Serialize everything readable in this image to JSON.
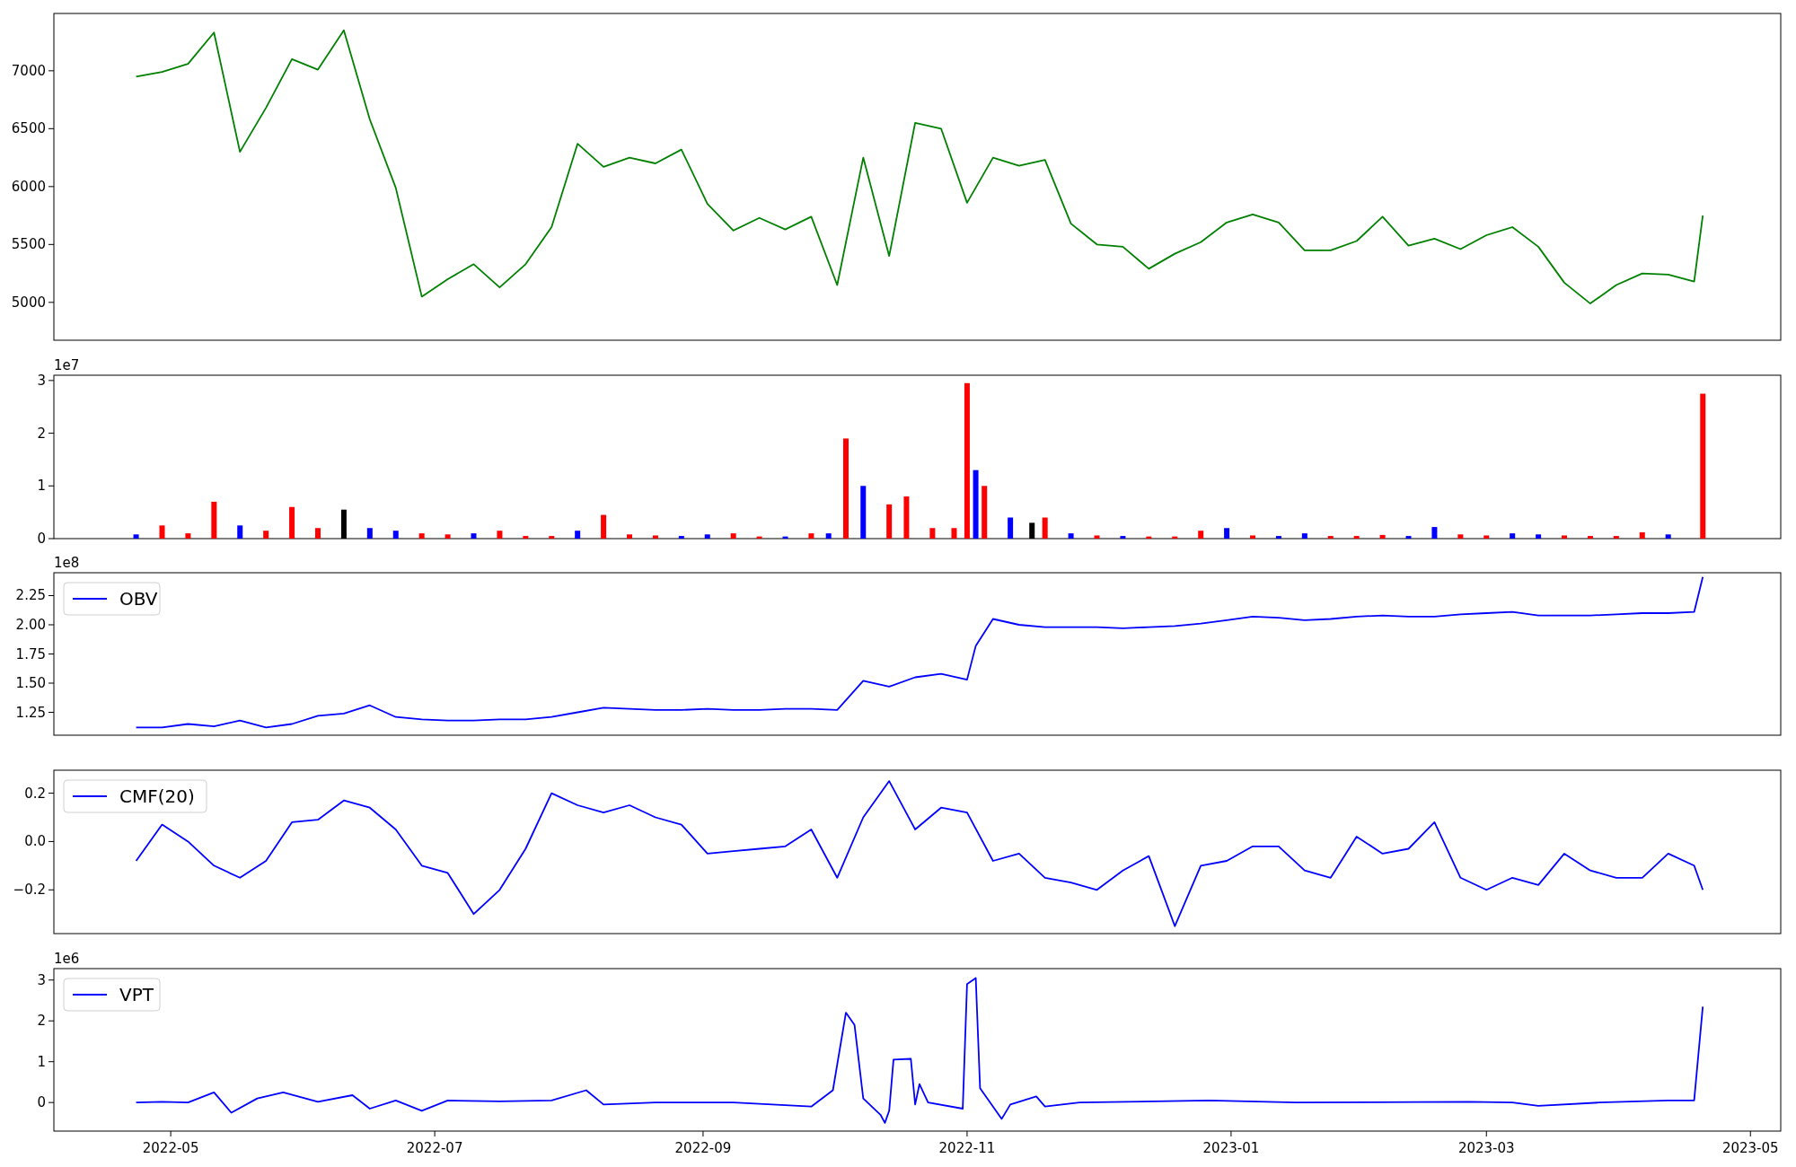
{
  "panels": [
    {
      "chart_data": {
        "type": "line",
        "x": [
          "2022-04-23",
          "2022-04-29",
          "2022-05-05",
          "2022-05-11",
          "2022-05-17",
          "2022-05-23",
          "2022-05-29",
          "2022-06-04",
          "2022-06-10",
          "2022-06-16",
          "2022-06-22",
          "2022-06-28",
          "2022-07-04",
          "2022-07-10",
          "2022-07-16",
          "2022-07-22",
          "2022-07-28",
          "2022-08-03",
          "2022-08-09",
          "2022-08-15",
          "2022-08-21",
          "2022-08-27",
          "2022-09-02",
          "2022-09-08",
          "2022-09-14",
          "2022-09-20",
          "2022-09-26",
          "2022-10-02",
          "2022-10-08",
          "2022-10-14",
          "2022-10-20",
          "2022-10-26",
          "2022-11-01",
          "2022-11-07",
          "2022-11-13",
          "2022-11-19",
          "2022-11-25",
          "2022-12-01",
          "2022-12-07",
          "2022-12-13",
          "2022-12-19",
          "2022-12-25",
          "2022-12-31",
          "2023-01-06",
          "2023-01-12",
          "2023-01-18",
          "2023-01-24",
          "2023-01-30",
          "2023-02-05",
          "2023-02-11",
          "2023-02-17",
          "2023-02-23",
          "2023-03-01",
          "2023-03-07",
          "2023-03-13",
          "2023-03-19",
          "2023-03-25",
          "2023-03-31",
          "2023-04-06",
          "2023-04-12",
          "2023-04-18",
          "2023-04-20"
        ],
        "xlim": [
          "2022-04-04",
          "2023-05-08"
        ],
        "ylim": [
          4673,
          7495
        ],
        "yticks": [
          5000,
          5500,
          6000,
          6500,
          7000
        ],
        "series": [
          {
            "color": "#008000",
            "values": [
              6950,
              6990,
              7060,
              7330,
              6300,
              6680,
              7100,
              7010,
              7350,
              6580,
              5990,
              5050,
              5200,
              5330,
              5130,
              5330,
              5650,
              6370,
              6170,
              6250,
              6200,
              6320,
              5850,
              5620,
              5730,
              5630,
              5740,
              5150,
              6250,
              5400,
              6550,
              6500,
              5860,
              6250,
              6180,
              6230,
              5680,
              5500,
              5480,
              5290,
              5420,
              5520,
              5690,
              5760,
              5690,
              5450,
              5450,
              5530,
              5740,
              5490,
              5550,
              5460,
              5580,
              5650,
              5480,
              5170,
              4990,
              5150,
              5250,
              5240,
              5180,
              5750
            ]
          }
        ]
      }
    },
    {
      "offset_label": "1e7",
      "chart_data": {
        "type": "bar",
        "x": [
          "2022-04-23",
          "2022-04-29",
          "2022-05-05",
          "2022-05-11",
          "2022-05-17",
          "2022-05-23",
          "2022-05-29",
          "2022-06-04",
          "2022-06-10",
          "2022-06-16",
          "2022-06-22",
          "2022-06-28",
          "2022-07-04",
          "2022-07-10",
          "2022-07-16",
          "2022-07-22",
          "2022-07-28",
          "2022-08-03",
          "2022-08-09",
          "2022-08-15",
          "2022-08-21",
          "2022-08-27",
          "2022-09-02",
          "2022-09-08",
          "2022-09-14",
          "2022-09-20",
          "2022-09-26",
          "2022-09-30",
          "2022-10-04",
          "2022-10-08",
          "2022-10-14",
          "2022-10-18",
          "2022-10-24",
          "2022-10-29",
          "2022-11-01",
          "2022-11-03",
          "2022-11-05",
          "2022-11-11",
          "2022-11-16",
          "2022-11-19",
          "2022-11-25",
          "2022-12-01",
          "2022-12-07",
          "2022-12-13",
          "2022-12-19",
          "2022-12-25",
          "2022-12-31",
          "2023-01-06",
          "2023-01-12",
          "2023-01-18",
          "2023-01-24",
          "2023-01-30",
          "2023-02-05",
          "2023-02-11",
          "2023-02-17",
          "2023-02-23",
          "2023-03-01",
          "2023-03-07",
          "2023-03-13",
          "2023-03-19",
          "2023-03-25",
          "2023-03-31",
          "2023-04-06",
          "2023-04-12",
          "2023-04-20"
        ],
        "xlim": [
          "2022-04-04",
          "2023-05-08"
        ],
        "ylim": [
          0,
          3.1
        ],
        "yticks": [
          0,
          1,
          2,
          3
        ],
        "series": [
          {
            "color": "#ff0000",
            "values": [
              null,
              0.25,
              0.1,
              0.7,
              null,
              0.15,
              0.6,
              0.2,
              null,
              null,
              null,
              0.1,
              0.08,
              null,
              0.15,
              0.05,
              0.05,
              null,
              0.45,
              0.08,
              0.06,
              null,
              null,
              0.1,
              0.04,
              null,
              0.1,
              null,
              1.9,
              null,
              0.65,
              0.8,
              0.2,
              0.2,
              2.95,
              null,
              1.0,
              null,
              null,
              0.4,
              null,
              0.06,
              null,
              0.04,
              0.04,
              0.15,
              null,
              0.06,
              null,
              null,
              0.05,
              0.05,
              0.07,
              null,
              null,
              0.08,
              0.06,
              null,
              null,
              0.06,
              0.05,
              0.05,
              0.12,
              null,
              2.75
            ]
          },
          {
            "color": "#0000ff",
            "values": [
              0.08,
              null,
              null,
              null,
              0.25,
              null,
              null,
              null,
              null,
              0.2,
              0.15,
              null,
              null,
              0.1,
              null,
              null,
              null,
              0.15,
              null,
              null,
              null,
              0.05,
              0.08,
              null,
              null,
              0.04,
              null,
              0.1,
              null,
              1.0,
              null,
              null,
              null,
              null,
              null,
              1.3,
              null,
              0.4,
              null,
              null,
              0.1,
              null,
              0.05,
              null,
              null,
              null,
              0.2,
              null,
              0.05,
              0.1,
              null,
              null,
              null,
              0.05,
              0.22,
              null,
              null,
              0.1,
              0.08,
              null,
              null,
              null,
              null,
              0.08,
              null
            ]
          },
          {
            "color": "#000000",
            "values": [
              null,
              null,
              null,
              null,
              null,
              null,
              null,
              null,
              0.55,
              null,
              null,
              null,
              null,
              null,
              null,
              null,
              null,
              null,
              null,
              null,
              null,
              null,
              null,
              null,
              null,
              null,
              null,
              null,
              null,
              null,
              null,
              null,
              null,
              null,
              null,
              null,
              null,
              null,
              0.3,
              null,
              null,
              null,
              null,
              null,
              null,
              null,
              null,
              null,
              null,
              null,
              null,
              null,
              null,
              null,
              null,
              null,
              null,
              null,
              null,
              null,
              null,
              null,
              null,
              null,
              null
            ]
          }
        ]
      }
    },
    {
      "offset_label": "1e8",
      "chart_data": {
        "type": "line",
        "x": [
          "2022-04-23",
          "2022-04-29",
          "2022-05-05",
          "2022-05-11",
          "2022-05-17",
          "2022-05-23",
          "2022-05-29",
          "2022-06-04",
          "2022-06-10",
          "2022-06-16",
          "2022-06-22",
          "2022-06-28",
          "2022-07-04",
          "2022-07-10",
          "2022-07-16",
          "2022-07-22",
          "2022-07-28",
          "2022-08-03",
          "2022-08-09",
          "2022-08-15",
          "2022-08-21",
          "2022-08-27",
          "2022-09-02",
          "2022-09-08",
          "2022-09-14",
          "2022-09-20",
          "2022-09-26",
          "2022-10-02",
          "2022-10-08",
          "2022-10-14",
          "2022-10-20",
          "2022-10-26",
          "2022-11-01",
          "2022-11-03",
          "2022-11-07",
          "2022-11-13",
          "2022-11-19",
          "2022-11-25",
          "2022-12-01",
          "2022-12-07",
          "2022-12-13",
          "2022-12-19",
          "2022-12-25",
          "2022-12-31",
          "2023-01-06",
          "2023-01-12",
          "2023-01-18",
          "2023-01-24",
          "2023-01-30",
          "2023-02-05",
          "2023-02-11",
          "2023-02-17",
          "2023-02-23",
          "2023-03-01",
          "2023-03-07",
          "2023-03-13",
          "2023-03-19",
          "2023-03-25",
          "2023-03-31",
          "2023-04-06",
          "2023-04-12",
          "2023-04-18",
          "2023-04-20"
        ],
        "xlim": [
          "2022-04-04",
          "2023-05-08"
        ],
        "ylim": [
          1.054,
          2.446
        ],
        "yticks": [
          {
            "value": 1.25,
            "label": "1.25"
          },
          {
            "value": 1.5,
            "label": "1.50"
          },
          {
            "value": 1.75,
            "label": "1.75"
          },
          {
            "value": 2.0,
            "label": "2.00"
          },
          {
            "value": 2.25,
            "label": "2.25"
          }
        ],
        "series": [
          {
            "name": "OBV",
            "color": "#0000ff",
            "values": [
              1.12,
              1.12,
              1.15,
              1.13,
              1.18,
              1.12,
              1.15,
              1.22,
              1.24,
              1.31,
              1.21,
              1.19,
              1.18,
              1.18,
              1.19,
              1.19,
              1.21,
              1.25,
              1.29,
              1.28,
              1.27,
              1.27,
              1.28,
              1.27,
              1.27,
              1.28,
              1.28,
              1.27,
              1.52,
              1.47,
              1.55,
              1.58,
              1.53,
              1.82,
              2.05,
              2.0,
              1.98,
              1.98,
              1.98,
              1.97,
              1.98,
              1.99,
              2.01,
              2.04,
              2.07,
              2.06,
              2.04,
              2.05,
              2.07,
              2.08,
              2.07,
              2.07,
              2.09,
              2.1,
              2.11,
              2.08,
              2.08,
              2.08,
              2.09,
              2.1,
              2.1,
              2.11,
              2.41
            ]
          }
        ]
      }
    },
    {
      "chart_data": {
        "type": "line",
        "x": [
          "2022-04-23",
          "2022-04-29",
          "2022-05-05",
          "2022-05-11",
          "2022-05-17",
          "2022-05-23",
          "2022-05-29",
          "2022-06-04",
          "2022-06-10",
          "2022-06-16",
          "2022-06-22",
          "2022-06-28",
          "2022-07-04",
          "2022-07-10",
          "2022-07-16",
          "2022-07-22",
          "2022-07-28",
          "2022-08-03",
          "2022-08-09",
          "2022-08-15",
          "2022-08-21",
          "2022-08-27",
          "2022-09-02",
          "2022-09-08",
          "2022-09-14",
          "2022-09-20",
          "2022-09-26",
          "2022-10-02",
          "2022-10-08",
          "2022-10-14",
          "2022-10-20",
          "2022-10-26",
          "2022-11-01",
          "2022-11-07",
          "2022-11-13",
          "2022-11-19",
          "2022-11-25",
          "2022-12-01",
          "2022-12-07",
          "2022-12-13",
          "2022-12-19",
          "2022-12-25",
          "2022-12-31",
          "2023-01-06",
          "2023-01-12",
          "2023-01-18",
          "2023-01-24",
          "2023-01-30",
          "2023-02-05",
          "2023-02-11",
          "2023-02-17",
          "2023-02-23",
          "2023-03-01",
          "2023-03-07",
          "2023-03-13",
          "2023-03-19",
          "2023-03-25",
          "2023-03-31",
          "2023-04-06",
          "2023-04-12",
          "2023-04-18",
          "2023-04-20"
        ],
        "xlim": [
          "2022-04-04",
          "2023-05-08"
        ],
        "ylim": [
          -0.381,
          0.295
        ],
        "yticks": [
          {
            "value": -0.2,
            "label": "−0.2"
          },
          {
            "value": 0,
            "label": "0.0"
          },
          {
            "value": 0.2,
            "label": "0.2"
          }
        ],
        "series": [
          {
            "name": "CMF(20)",
            "color": "#0000ff",
            "values": [
              -0.08,
              0.07,
              0.0,
              -0.1,
              -0.15,
              -0.08,
              0.08,
              0.09,
              0.17,
              0.14,
              0.05,
              -0.1,
              -0.13,
              -0.3,
              -0.2,
              -0.03,
              0.2,
              0.15,
              0.12,
              0.15,
              0.1,
              0.07,
              -0.05,
              -0.04,
              -0.03,
              -0.02,
              0.05,
              -0.15,
              0.1,
              0.25,
              0.05,
              0.14,
              0.12,
              -0.08,
              -0.05,
              -0.15,
              -0.17,
              -0.2,
              -0.12,
              -0.06,
              -0.35,
              -0.1,
              -0.08,
              -0.02,
              -0.02,
              -0.12,
              -0.15,
              0.02,
              -0.05,
              -0.03,
              0.08,
              -0.15,
              -0.2,
              -0.15,
              -0.18,
              -0.05,
              -0.12,
              -0.15,
              -0.15,
              -0.05,
              -0.1,
              -0.2
            ]
          }
        ]
      }
    },
    {
      "offset_label": "1e6",
      "chart_data": {
        "type": "line",
        "x": [
          "2022-04-23",
          "2022-04-29",
          "2022-05-05",
          "2022-05-11",
          "2022-05-15",
          "2022-05-21",
          "2022-05-27",
          "2022-06-04",
          "2022-06-12",
          "2022-06-16",
          "2022-06-22",
          "2022-06-28",
          "2022-07-04",
          "2022-07-16",
          "2022-07-28",
          "2022-08-05",
          "2022-08-09",
          "2022-08-21",
          "2022-09-08",
          "2022-09-26",
          "2022-10-01",
          "2022-10-04",
          "2022-10-06",
          "2022-10-08",
          "2022-10-12",
          "2022-10-13",
          "2022-10-14",
          "2022-10-15",
          "2022-10-19",
          "2022-10-20",
          "2022-10-21",
          "2022-10-23",
          "2022-10-31",
          "2022-11-01",
          "2022-11-03",
          "2022-11-04",
          "2022-11-09",
          "2022-11-11",
          "2022-11-17",
          "2022-11-19",
          "2022-11-27",
          "2022-12-27",
          "2023-01-16",
          "2023-02-25",
          "2023-03-07",
          "2023-03-13",
          "2023-03-27",
          "2023-04-12",
          "2023-04-18",
          "2023-04-20"
        ],
        "xlim": [
          "2022-04-04",
          "2023-05-08"
        ],
        "ylim": [
          -0.7,
          3.28
        ],
        "yticks": [
          0,
          1,
          2,
          3
        ],
        "xticks": [
          {
            "value": "2022-05-01",
            "label": "2022-05"
          },
          {
            "value": "2022-07-01",
            "label": "2022-07"
          },
          {
            "value": "2022-09-01",
            "label": "2022-09"
          },
          {
            "value": "2022-11-01",
            "label": "2022-11"
          },
          {
            "value": "2023-01-01",
            "label": "2023-01"
          },
          {
            "value": "2023-03-01",
            "label": "2023-03"
          },
          {
            "value": "2023-05-01",
            "label": "2023-05"
          }
        ],
        "series": [
          {
            "name": "VPT",
            "color": "#0000ff",
            "values": [
              0,
              0.02,
              0.0,
              0.25,
              -0.25,
              0.1,
              0.25,
              0.02,
              0.18,
              -0.15,
              0.05,
              -0.2,
              0.05,
              0.03,
              0.05,
              0.3,
              -0.05,
              0.0,
              0.0,
              -0.1,
              0.3,
              2.2,
              1.9,
              0.1,
              -0.3,
              -0.5,
              -0.2,
              1.05,
              1.07,
              -0.05,
              0.45,
              0.0,
              -0.15,
              2.9,
              3.05,
              0.35,
              -0.4,
              -0.05,
              0.15,
              -0.1,
              0.0,
              0.05,
              0.0,
              0.02,
              0.0,
              -0.08,
              0.0,
              0.05,
              0.05,
              2.35
            ]
          }
        ]
      }
    }
  ]
}
